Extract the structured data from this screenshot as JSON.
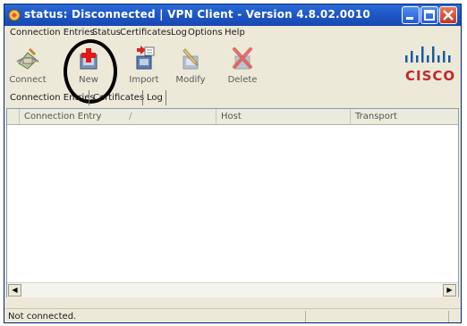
{
  "window": {
    "title": "status: Disconnected | VPN Client - Version 4.8.02.0010",
    "buttons": [
      "minimize-icon",
      "maximize-icon",
      "close-icon"
    ]
  },
  "menu": [
    "Connection Entries",
    "Status",
    "Certificates",
    "Log",
    "Options",
    "Help"
  ],
  "toolbar": {
    "connect_label": "Connect",
    "new_label": "New",
    "import_label": "Import",
    "modify_label": "Modify",
    "delete_label": "Delete"
  },
  "brand": {
    "logo": "CISCO",
    "accent": "#c1272d",
    "bars_color": "#1a5a9e"
  },
  "tabs": [
    "Connection Entries",
    "Certificates",
    "Log"
  ],
  "table": {
    "columns": [
      "Connection Entry",
      "Host",
      "Transport"
    ],
    "rows": []
  },
  "status": {
    "text": "Not connected."
  }
}
